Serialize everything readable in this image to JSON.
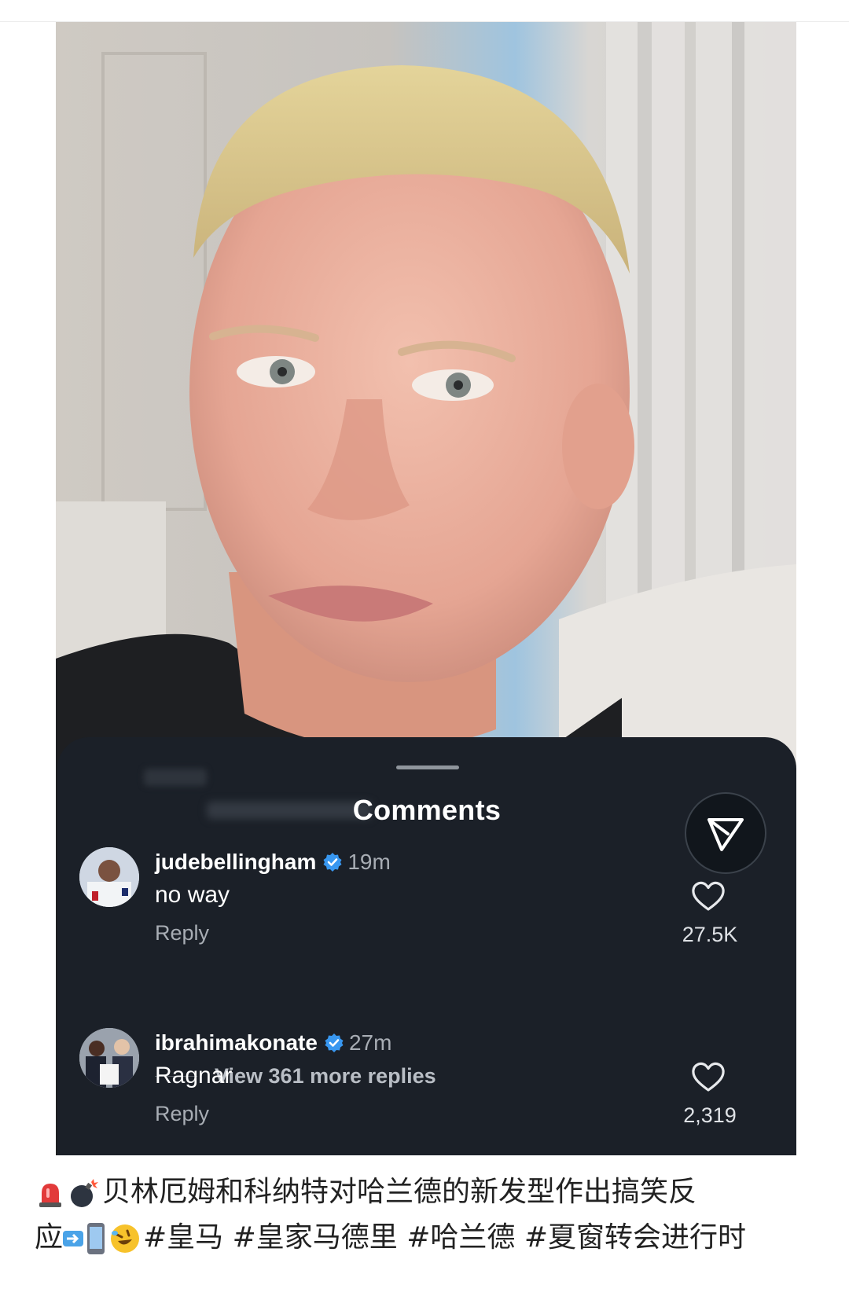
{
  "comments_sheet": {
    "title": "Comments",
    "comments": [
      {
        "username": "judebellingham",
        "verified": true,
        "time": "19m",
        "text": "no way",
        "reply_label": "Reply",
        "likes": "27.5K",
        "more_replies": "View 361 more replies"
      },
      {
        "username": "ibrahimakonate",
        "verified": true,
        "time": "27m",
        "text": "Ragnar",
        "reply_label": "Reply",
        "likes": "2,319"
      }
    ]
  },
  "caption": {
    "line1": "贝林厄姆和科纳特对哈兰德的新发型作出搞笑反",
    "line2_prefix": "应",
    "hashtags": [
      "#皇马",
      "#皇家马德里",
      "#哈兰德",
      "#夏窗转会进行时"
    ]
  },
  "colors": {
    "sheet_bg": "#1b2028",
    "verified_blue": "#3897f0",
    "secondary_text": "#a8adb4"
  },
  "icons": [
    "siren-icon",
    "bomb-icon",
    "arrow-right-icon",
    "phone-icon",
    "rolling-laugh-icon",
    "send-icon",
    "heart-icon",
    "verified-badge-icon"
  ]
}
